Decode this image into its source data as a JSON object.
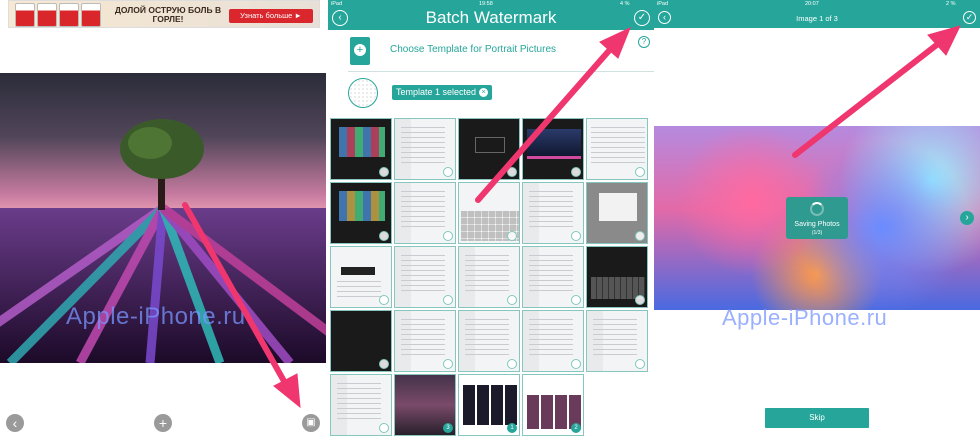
{
  "panel1": {
    "ad": {
      "title": "ДОЛОЙ ОСТРУЮ БОЛЬ В ГОРЛЕ!",
      "button": "Узнать больше ►"
    },
    "watermark": "Apple-iPhone.ru",
    "toolbar": {
      "back_icon": "chevron-left-icon",
      "add_icon": "plus-icon",
      "save_icon": "save-icon"
    }
  },
  "panel2": {
    "status": {
      "carrier": "iPad",
      "time": "19:58",
      "battery": "4 %"
    },
    "title": "Batch Watermark",
    "template_prompt": "Choose Template for Portrait Pictures",
    "selected_pill": "Template 1 selected",
    "accent": "#26a69a",
    "badges": [
      "3",
      "1",
      "2"
    ]
  },
  "panel3": {
    "status": {
      "carrier": "iPad",
      "time": "20:07",
      "battery": "2 %"
    },
    "title": "Image 1 of 3",
    "watermark": "Apple-iPhone.ru",
    "saving": {
      "label": "Saving Photos",
      "count": "(1/3)"
    },
    "skip": "Skip"
  }
}
